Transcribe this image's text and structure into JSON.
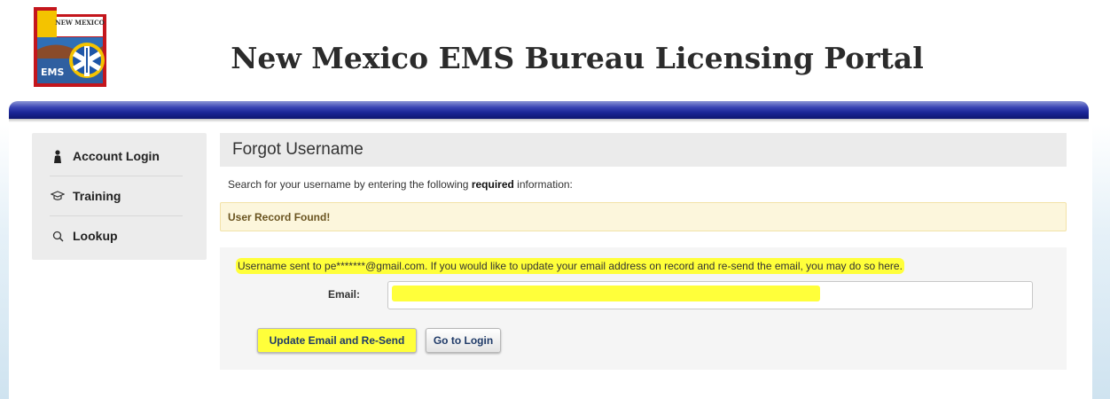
{
  "header": {
    "title": "New Mexico EMS Bureau Licensing Portal",
    "logo_text_top": "NEW MEXICO",
    "logo_text_bottom": "EMS"
  },
  "sidebar": {
    "items": [
      {
        "label": "Account Login",
        "icon": "person-icon"
      },
      {
        "label": "Training",
        "icon": "graduation-cap-icon"
      },
      {
        "label": "Lookup",
        "icon": "search-icon"
      }
    ]
  },
  "main": {
    "panel_title": "Forgot Username",
    "instruction_prefix": "Search for your username by entering the following ",
    "instruction_bold": "required",
    "instruction_suffix": " information:",
    "alert": "User Record Found!",
    "sent_message": "Username sent to pe*******@gmail.com. If you would like to update your email address on record and re-send the email, you may do so here.",
    "email_label": "Email:",
    "email_value": "",
    "update_button": "Update Email and Re-Send",
    "login_button": "Go to Login"
  },
  "colors": {
    "header_bar": "#1b2697",
    "highlight": "#ffff3a",
    "alert_bg": "#fcf6dc"
  }
}
